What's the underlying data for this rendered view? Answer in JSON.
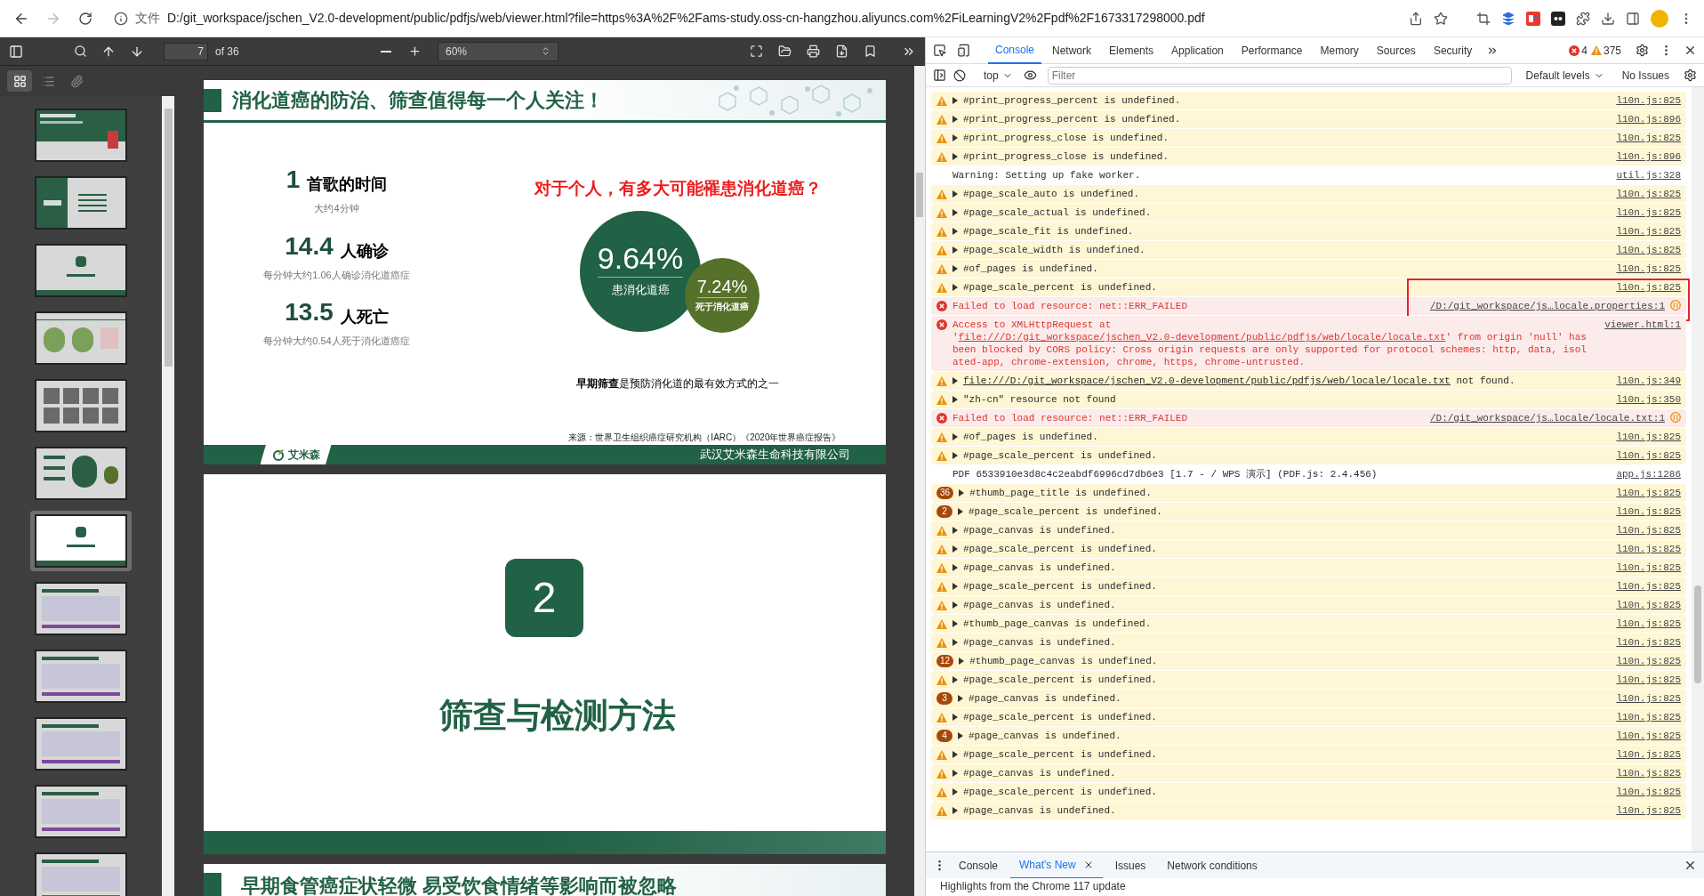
{
  "browser": {
    "scheme_label": "文件",
    "url": "D:/git_workspace/jschen_V2.0-development/public/pdfjs/web/viewer.html?file=https%3A%2F%2Fams-study.oss-cn-hangzhou.aliyuncs.com%2FiLearningV2%2Fpdf%2F1673317298000.pdf",
    "forward_disabled": true
  },
  "pdf_toolbar": {
    "page": "7",
    "page_count": "of 36",
    "zoom": "60%"
  },
  "sidebar_tabs": [
    {
      "kind": "thumbnails",
      "selected": true
    },
    {
      "kind": "outline",
      "selected": false
    },
    {
      "kind": "attachments",
      "selected": false
    }
  ],
  "thumbnails": [
    {
      "kind": "title",
      "selected": false
    },
    {
      "kind": "toc",
      "selected": false
    },
    {
      "kind": "section",
      "selected": false
    },
    {
      "kind": "pies",
      "selected": false
    },
    {
      "kind": "people",
      "selected": false
    },
    {
      "kind": "stats",
      "selected": false
    },
    {
      "kind": "section",
      "selected": true
    },
    {
      "kind": "content",
      "selected": false
    },
    {
      "kind": "content",
      "selected": false
    },
    {
      "kind": "content",
      "selected": false
    },
    {
      "kind": "content",
      "selected": false
    },
    {
      "kind": "content",
      "selected": false
    }
  ],
  "slides": [
    {
      "kind": "stats",
      "title": "消化道癌的防治、筛查值得每一个人关注！",
      "stats": [
        {
          "number": "1",
          "unit": "首歌的时间",
          "note": "大约4分钟"
        },
        {
          "number": "14.4",
          "unit": "人确诊",
          "note": "每分钟大约1.06人确诊消化道癌症"
        },
        {
          "number": "13.5",
          "unit": "人死亡",
          "note": "每分钟大约0.54人死于消化道癌症"
        }
      ],
      "question": "对于个人，有多大可能罹患消化道癌？",
      "circles": [
        {
          "value": "9.64%",
          "label": "患消化道癌",
          "color": "#216145"
        },
        {
          "value": "7.24%",
          "label": "死于消化道癌",
          "color": "#56712a"
        }
      ],
      "statement": "**早期筛查**是预防消化道的最有效方式的之一",
      "source": "来源：世界卫生组织癌症研究机构（IARC）《2020年世界癌症报告》",
      "logo_text": "艾米森",
      "company": "武汉艾米森生命科技有限公司"
    },
    {
      "kind": "section",
      "number": "2",
      "title": "筛查与检测方法"
    },
    {
      "kind": "header",
      "title": "早期食管癌症状轻微 易受饮食情绪等影响而被忽略"
    }
  ],
  "devtools": {
    "tabs": [
      {
        "label": "Console",
        "selected": true
      },
      {
        "label": "Network",
        "selected": false
      },
      {
        "label": "Elements",
        "selected": false
      },
      {
        "label": "Application",
        "selected": false
      },
      {
        "label": "Performance",
        "selected": false
      },
      {
        "label": "Memory",
        "selected": false
      },
      {
        "label": "Sources",
        "selected": false
      },
      {
        "label": "Security",
        "selected": false
      }
    ],
    "error_count": "4",
    "warning_count": "375",
    "context": "top",
    "filter_placeholder": "Filter",
    "levels": "Default levels",
    "issues": "No Issues"
  },
  "console": [
    {
      "kind": "warning",
      "text": "#print_progress_percent is undefined.",
      "source": "l10n.js:825"
    },
    {
      "kind": "warning",
      "text": "#print_progress_percent is undefined.",
      "source": "l10n.js:896"
    },
    {
      "kind": "warning",
      "text": "#print_progress_close is undefined.",
      "source": "l10n.js:825"
    },
    {
      "kind": "warning",
      "text": "#print_progress_close is undefined.",
      "source": "l10n.js:896"
    },
    {
      "kind": "info",
      "text": "Warning: Setting up fake worker.",
      "source": "util.js:328"
    },
    {
      "kind": "warning",
      "text": "#page_scale_auto is undefined.",
      "source": "l10n.js:825"
    },
    {
      "kind": "warning",
      "text": "#page_scale_actual is undefined.",
      "source": "l10n.js:825"
    },
    {
      "kind": "warning",
      "text": "#page_scale_fit is undefined.",
      "source": "l10n.js:825"
    },
    {
      "kind": "warning",
      "text": "#page_scale_width is undefined.",
      "source": "l10n.js:825"
    },
    {
      "kind": "warning",
      "text": "#of_pages is undefined.",
      "source": "l10n.js:825"
    },
    {
      "kind": "warning",
      "text": "#page_scale_percent is undefined.",
      "source": "l10n.js:825"
    },
    {
      "kind": "error",
      "text": "Failed to load resource: net::ERR_FAILED",
      "source": "/D:/git_workspace/js…locale.properties:1",
      "annotated": true
    },
    {
      "kind": "error",
      "text": "Access to XMLHttpRequest at '",
      "link": "file:///D:/git_workspace/jschen_V2.0-development/public/pdfjs/web/locale/locale.txt",
      "after": "' from origin 'null' has been blocked by CORS policy: Cross origin requests are only supported for protocol schemes: http, data, isolated-app, chrome-extension, chrome, https, chrome-untrusted.",
      "source": "viewer.html:1"
    },
    {
      "kind": "warning",
      "link": "file:///D:/git_workspace/jschen_V2.0-development/public/pdfjs/web/locale/locale.txt",
      "after": " not found.",
      "source": "l10n.js:349"
    },
    {
      "kind": "warning",
      "text": "\"zh-cn\" resource not found",
      "source": "l10n.js:350"
    },
    {
      "kind": "error",
      "text": "Failed to load resource: net::ERR_FAILED",
      "source": "/D:/git_workspace/js…locale/locale.txt:1"
    },
    {
      "kind": "warning",
      "text": "#of_pages is undefined.",
      "source": "l10n.js:825"
    },
    {
      "kind": "warning",
      "text": "#page_scale_percent is undefined.",
      "source": "l10n.js:825"
    },
    {
      "kind": "info",
      "text": "PDF 6533910e3d8c4c2eabdf6996cd7db6e3 [1.7 - / WPS 演示] (PDF.js: 2.4.456)",
      "source": "app.js:1286"
    },
    {
      "kind": "warning",
      "count": "36",
      "text": "#thumb_page_title is undefined.",
      "source": "l10n.js:825"
    },
    {
      "kind": "warning",
      "count": "2",
      "text": "#page_scale_percent is undefined.",
      "source": "l10n.js:825"
    },
    {
      "kind": "warning",
      "text": "#page_canvas is undefined.",
      "source": "l10n.js:825"
    },
    {
      "kind": "warning",
      "text": "#page_scale_percent is undefined.",
      "source": "l10n.js:825"
    },
    {
      "kind": "warning",
      "text": "#page_canvas is undefined.",
      "source": "l10n.js:825"
    },
    {
      "kind": "warning",
      "text": "#page_scale_percent is undefined.",
      "source": "l10n.js:825"
    },
    {
      "kind": "warning",
      "text": "#page_canvas is undefined.",
      "source": "l10n.js:825"
    },
    {
      "kind": "warning",
      "text": "#thumb_page_canvas is undefined.",
      "source": "l10n.js:825"
    },
    {
      "kind": "warning",
      "text": "#page_canvas is undefined.",
      "source": "l10n.js:825"
    },
    {
      "kind": "warning",
      "count": "12",
      "text": "#thumb_page_canvas is undefined.",
      "source": "l10n.js:825"
    },
    {
      "kind": "warning",
      "text": "#page_scale_percent is undefined.",
      "source": "l10n.js:825"
    },
    {
      "kind": "warning",
      "count": "3",
      "text": "#page_canvas is undefined.",
      "source": "l10n.js:825"
    },
    {
      "kind": "warning",
      "text": "#page_scale_percent is undefined.",
      "source": "l10n.js:825"
    },
    {
      "kind": "warning",
      "count": "4",
      "text": "#page_canvas is undefined.",
      "source": "l10n.js:825"
    },
    {
      "kind": "warning",
      "text": "#page_scale_percent is undefined.",
      "source": "l10n.js:825"
    },
    {
      "kind": "warning",
      "text": "#page_canvas is undefined.",
      "source": "l10n.js:825"
    },
    {
      "kind": "warning",
      "text": "#page_scale_percent is undefined.",
      "source": "l10n.js:825"
    },
    {
      "kind": "warning",
      "text": "#page_canvas is undefined.",
      "source": "l10n.js:825"
    }
  ],
  "drawer": {
    "tabs": [
      {
        "label": "Console",
        "selected": false,
        "closable": false
      },
      {
        "label": "What's New",
        "selected": true,
        "closable": true
      },
      {
        "label": "Issues",
        "selected": false,
        "closable": false
      },
      {
        "label": "Network conditions",
        "selected": false,
        "closable": false
      }
    ],
    "content": "Highlights from the Chrome 117 update"
  }
}
